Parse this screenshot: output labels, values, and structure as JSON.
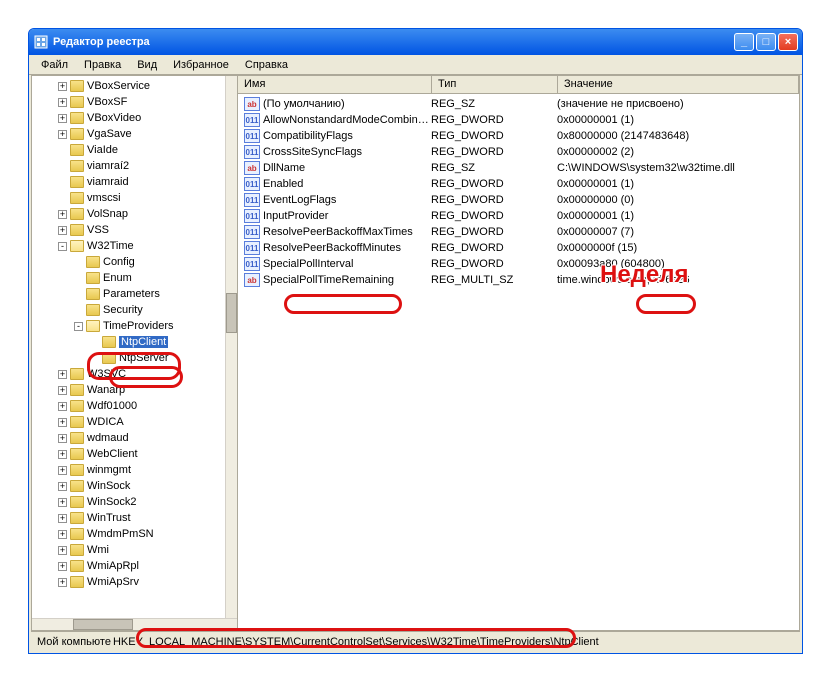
{
  "window": {
    "title": "Редактор реестра"
  },
  "menu": {
    "file": "Файл",
    "edit": "Правка",
    "view": "Вид",
    "fav": "Избранное",
    "help": "Справка"
  },
  "tree": [
    {
      "d": 1,
      "pm": "+",
      "l": "VBoxService"
    },
    {
      "d": 1,
      "pm": "+",
      "l": "VBoxSF"
    },
    {
      "d": 1,
      "pm": "+",
      "l": "VBoxVideo"
    },
    {
      "d": 1,
      "pm": "+",
      "l": "VgaSave"
    },
    {
      "d": 1,
      "pm": "",
      "l": "ViaIde"
    },
    {
      "d": 1,
      "pm": "",
      "l": "viamraí2"
    },
    {
      "d": 1,
      "pm": "",
      "l": "viamraid"
    },
    {
      "d": 1,
      "pm": "",
      "l": "vmscsi"
    },
    {
      "d": 1,
      "pm": "+",
      "l": "VolSnap"
    },
    {
      "d": 1,
      "pm": "+",
      "l": "VSS"
    },
    {
      "d": 1,
      "pm": "-",
      "l": "W32Time",
      "open": true
    },
    {
      "d": 2,
      "pm": "",
      "l": "Config"
    },
    {
      "d": 2,
      "pm": "",
      "l": "Enum"
    },
    {
      "d": 2,
      "pm": "",
      "l": "Parameters"
    },
    {
      "d": 2,
      "pm": "",
      "l": "Security"
    },
    {
      "d": 2,
      "pm": "-",
      "l": "TimeProviders",
      "open": true
    },
    {
      "d": 3,
      "pm": "",
      "l": "NtpClient",
      "sel": true
    },
    {
      "d": 3,
      "pm": "",
      "l": "NtpServer"
    },
    {
      "d": 1,
      "pm": "+",
      "l": "W3SVC"
    },
    {
      "d": 1,
      "pm": "+",
      "l": "Wanarp"
    },
    {
      "d": 1,
      "pm": "+",
      "l": "Wdf01000"
    },
    {
      "d": 1,
      "pm": "+",
      "l": "WDICA"
    },
    {
      "d": 1,
      "pm": "+",
      "l": "wdmaud"
    },
    {
      "d": 1,
      "pm": "+",
      "l": "WebClient"
    },
    {
      "d": 1,
      "pm": "+",
      "l": "winmgmt"
    },
    {
      "d": 1,
      "pm": "+",
      "l": "WinSock"
    },
    {
      "d": 1,
      "pm": "+",
      "l": "WinSock2"
    },
    {
      "d": 1,
      "pm": "+",
      "l": "WinTrust"
    },
    {
      "d": 1,
      "pm": "+",
      "l": "WmdmPmSN"
    },
    {
      "d": 1,
      "pm": "+",
      "l": "Wmi"
    },
    {
      "d": 1,
      "pm": "+",
      "l": "WmiApRpl"
    },
    {
      "d": 1,
      "pm": "+",
      "l": "WmiApSrv"
    }
  ],
  "cols": {
    "name": "Имя",
    "type": "Тип",
    "value": "Значение"
  },
  "values": [
    {
      "t": "sz",
      "n": "(По умолчанию)",
      "ty": "REG_SZ",
      "v": "(значение не присвоено)"
    },
    {
      "t": "bin",
      "n": "AllowNonstandardModeCombina...",
      "ty": "REG_DWORD",
      "v": "0x00000001 (1)"
    },
    {
      "t": "bin",
      "n": "CompatibilityFlags",
      "ty": "REG_DWORD",
      "v": "0x80000000 (2147483648)"
    },
    {
      "t": "bin",
      "n": "CrossSiteSyncFlags",
      "ty": "REG_DWORD",
      "v": "0x00000002 (2)"
    },
    {
      "t": "sz",
      "n": "DllName",
      "ty": "REG_SZ",
      "v": "C:\\WINDOWS\\system32\\w32time.dll"
    },
    {
      "t": "bin",
      "n": "Enabled",
      "ty": "REG_DWORD",
      "v": "0x00000001 (1)"
    },
    {
      "t": "bin",
      "n": "EventLogFlags",
      "ty": "REG_DWORD",
      "v": "0x00000000 (0)"
    },
    {
      "t": "bin",
      "n": "InputProvider",
      "ty": "REG_DWORD",
      "v": "0x00000001 (1)"
    },
    {
      "t": "bin",
      "n": "ResolvePeerBackoffMaxTimes",
      "ty": "REG_DWORD",
      "v": "0x00000007 (7)"
    },
    {
      "t": "bin",
      "n": "ResolvePeerBackoffMinutes",
      "ty": "REG_DWORD",
      "v": "0x0000000f (15)"
    },
    {
      "t": "bin",
      "n": "SpecialPollInterval",
      "ty": "REG_DWORD",
      "v": "0x00093a80 (604800)"
    },
    {
      "t": "sz",
      "n": "SpecialPollTimeRemaining",
      "ty": "REG_MULTI_SZ",
      "v": "time.windows.com,7df6e26"
    }
  ],
  "status": {
    "prefix": "Мой компьюте",
    "path": "HKEY_LOCAL_MACHINE\\SYSTEM\\CurrentControlSet\\Services\\W32Time\\TimeProviders\\NtpClient"
  },
  "annot": {
    "week": "Неделя"
  }
}
